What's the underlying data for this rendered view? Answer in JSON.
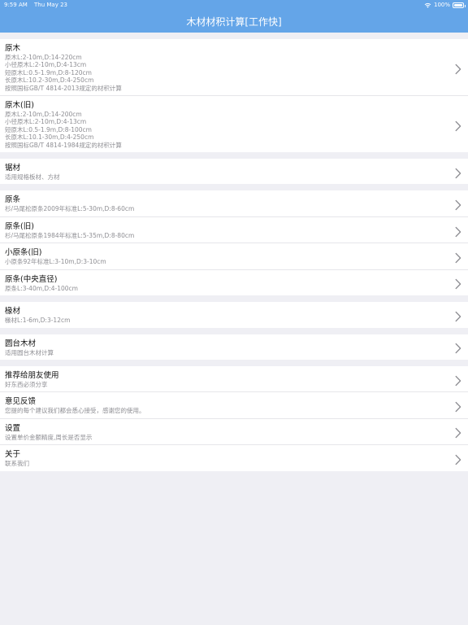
{
  "status_bar": {
    "time": "9:59 AM",
    "date": "Thu May 23",
    "battery": "100%",
    "icons": [
      "wifi-icon",
      "battery-icon"
    ]
  },
  "nav": {
    "title": "木材材积计算[工作快]"
  },
  "groups": [
    {
      "items": [
        {
          "title": "原木",
          "lines": [
            "原木L:2-10m,D:14-220cm",
            "小径原木L:2-10m,D:4-13cm",
            "短原木L:0.5-1.9m,D:8-120cm",
            "长原木L:10.2-30m,D:4-250cm",
            "按照国标GB/T 4814-2013规定的材积计算"
          ]
        },
        {
          "title": "原木(旧)",
          "lines": [
            "原木L:2-10m,D:14-200cm",
            "小径原木L:2-10m,D:4-13cm",
            "短原木L:0.5-1.9m,D:8-100cm",
            "长原木L:10.1-30m,D:4-250cm",
            "按照国标GB/T 4814-1984规定的材积计算"
          ]
        }
      ]
    },
    {
      "items": [
        {
          "title": "锯材",
          "lines": [
            "适用规格板材、方材"
          ]
        }
      ]
    },
    {
      "items": [
        {
          "title": "原条",
          "lines": [
            "杉/马尾松原条2009年标准L:5-30m,D:8-60cm"
          ]
        },
        {
          "title": "原条(旧)",
          "lines": [
            "杉/马尾松原条1984年标准L:5-35m,D:8-80cm"
          ]
        },
        {
          "title": "小原条(旧)",
          "lines": [
            "小原条92年标准L:3-10m,D:3-10cm"
          ]
        },
        {
          "title": "原条(中央直径)",
          "lines": [
            "原条L:3-40m,D:4-100cm"
          ]
        }
      ]
    },
    {
      "items": [
        {
          "title": "椽材",
          "lines": [
            "椽材L:1-6m,D:3-12cm"
          ]
        }
      ]
    },
    {
      "items": [
        {
          "title": "圆台木材",
          "lines": [
            "适用圆台木材计算"
          ]
        }
      ]
    },
    {
      "items": [
        {
          "title": "推荐给朋友使用",
          "lines": [
            "好东西必须分享"
          ]
        },
        {
          "title": "意见反馈",
          "lines": [
            "您提的每个建议我们都会悉心接受，感谢您的使用。"
          ]
        },
        {
          "title": "设置",
          "lines": [
            "设置单价金额精度,周长是否显示"
          ]
        },
        {
          "title": "关于",
          "lines": [
            "联系我们"
          ]
        }
      ]
    }
  ],
  "colors": {
    "accent": "#64a5e8",
    "background": "#efeff4",
    "subtitle": "#8e8e93",
    "chevron": "#8e8e93"
  }
}
